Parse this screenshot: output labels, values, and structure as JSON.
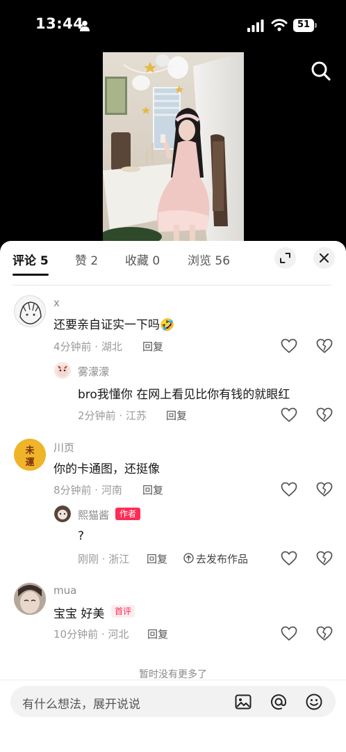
{
  "status_bar": {
    "time": "13:44",
    "battery": "51"
  },
  "tabs": [
    {
      "label": "评论 5"
    },
    {
      "label": "赞 2"
    },
    {
      "label": "收藏 0"
    },
    {
      "label": "浏览 56"
    }
  ],
  "comments": [
    {
      "username": "x",
      "content": "还要亲自证实一下吗🤣",
      "meta": "4分钟前 · 湖北",
      "reply_label": "回复",
      "replies": [
        {
          "username": "雾濛濛",
          "content": "bro我懂你 在网上看见比你有钱的就眼红",
          "meta": "2分钟前 · 江苏",
          "reply_label": "回复"
        }
      ]
    },
    {
      "username": "川页",
      "content": "你的卡通图，还挺像",
      "meta": "8分钟前 · 河南",
      "reply_label": "回复",
      "replies": [
        {
          "username": "熙猫酱",
          "badge": "作者",
          "content": "?",
          "meta": "刚刚 · 浙江",
          "reply_label": "回复",
          "extra": "去发布作品"
        }
      ]
    },
    {
      "username": "mua",
      "content": "宝宝 好美",
      "badge": "首评",
      "meta": "10分钟前 · 河北",
      "reply_label": "回复"
    }
  ],
  "end_text": "暂时没有更多了",
  "input": {
    "placeholder": "有什么想法，展开说说"
  },
  "icons": [
    "person-icon",
    "signal-icon",
    "wifi-icon",
    "battery-icon",
    "search-icon",
    "expand-icon",
    "close-icon",
    "heart-icon",
    "broken-heart-icon",
    "image-icon",
    "at-icon",
    "emoji-icon",
    "upload-icon"
  ],
  "colors": {
    "accent": "#fe2c55",
    "text": "#161616",
    "muted": "#9a9a9a"
  }
}
